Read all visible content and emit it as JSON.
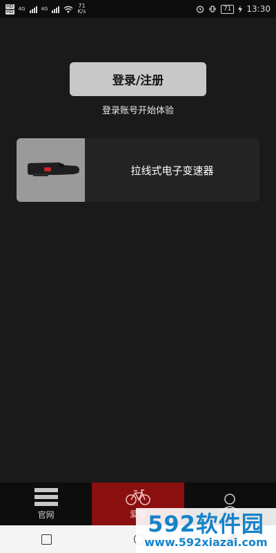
{
  "status_bar": {
    "hd1": "HD",
    "hd2": "HD",
    "net1": "4G",
    "net2": "4G",
    "speed_value": "71",
    "speed_unit": "K/s",
    "battery": "71",
    "time": "13:30"
  },
  "login": {
    "button_label": "登录/注册",
    "hint": "登录账号开始体验"
  },
  "device": {
    "name": "拉线式电子变速器"
  },
  "tabs": [
    {
      "label": "官网",
      "icon": "menu-icon"
    },
    {
      "label": "爱车",
      "icon": "bicycle-icon"
    },
    {
      "label": "",
      "icon": "user-icon"
    }
  ],
  "watermark": {
    "title": "592软件园",
    "url": "www.592xiazai.com"
  },
  "colors": {
    "background": "#1a1a1a",
    "accent": "#8a0f0f",
    "watermark": "#1683c9"
  }
}
